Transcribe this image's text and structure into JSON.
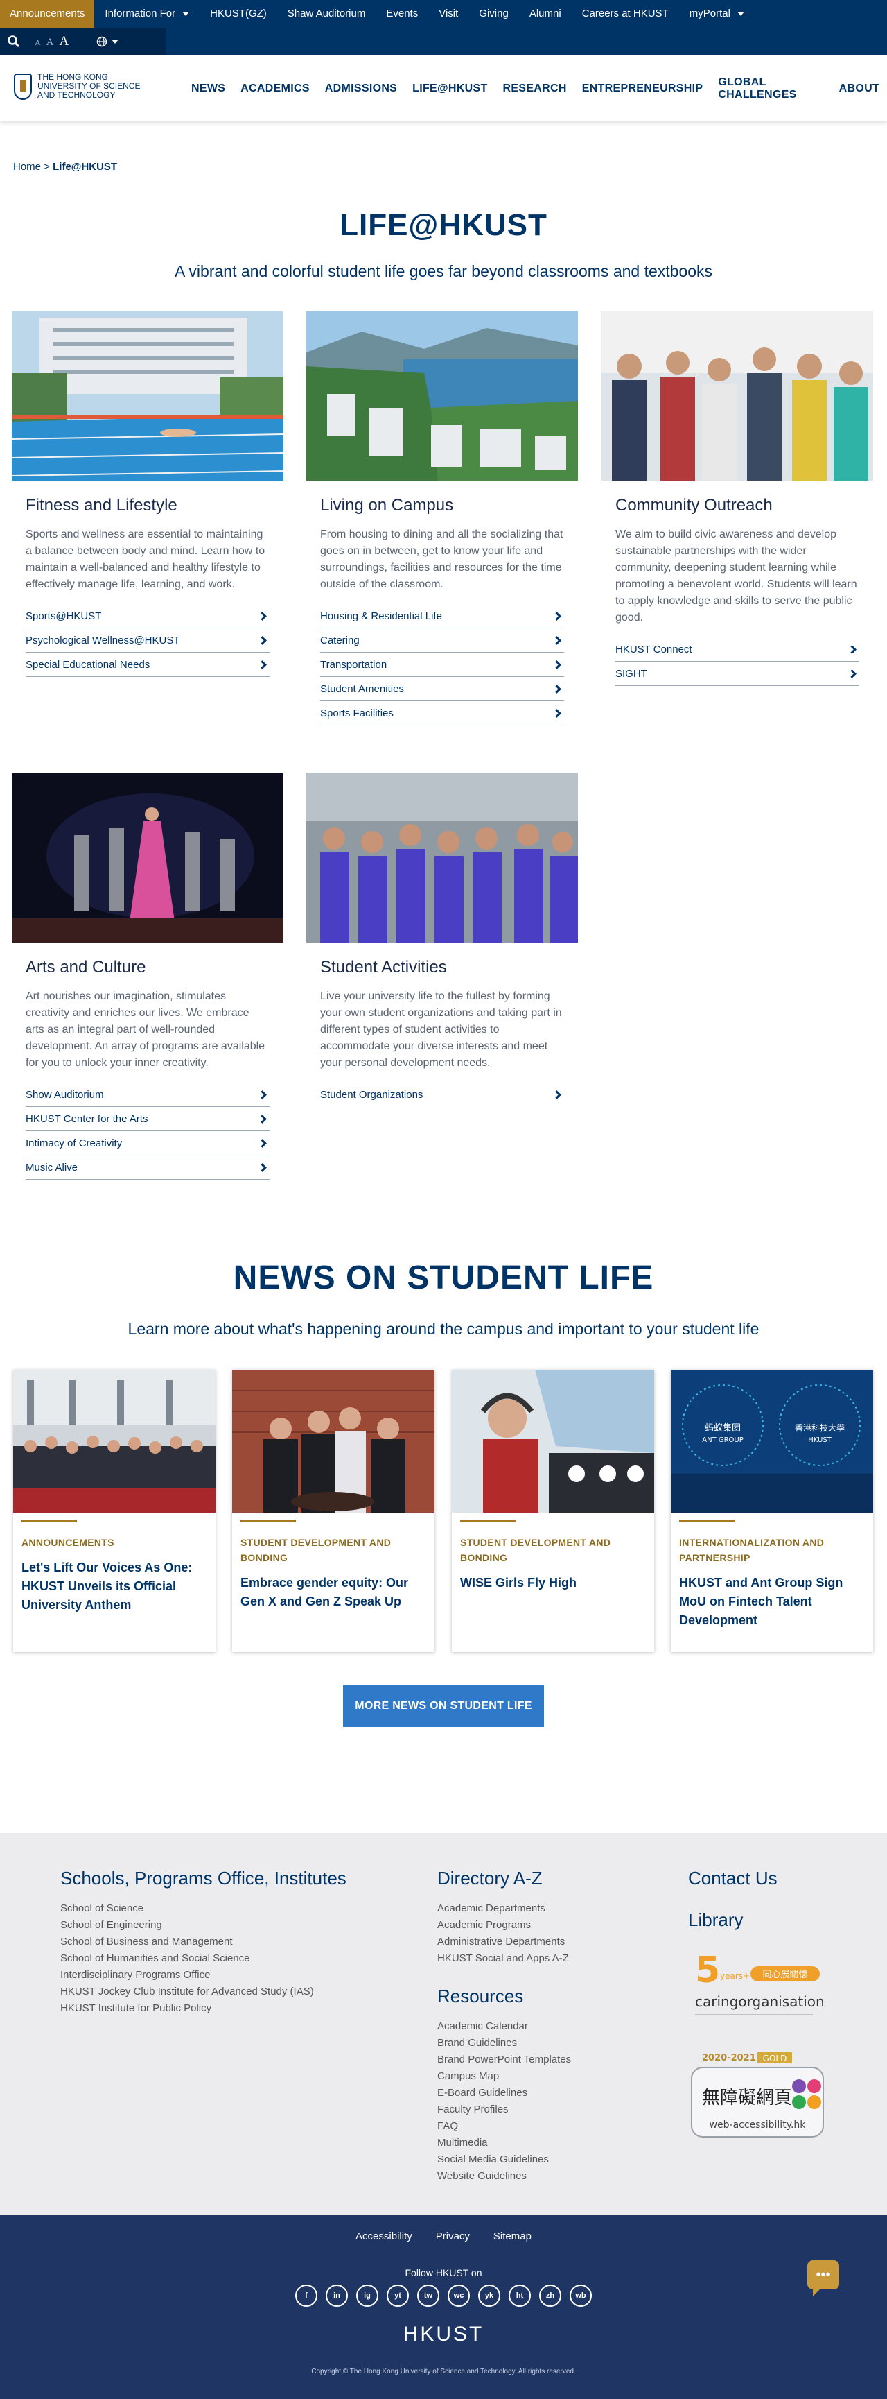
{
  "topnav": {
    "announcements": "Announcements",
    "items": [
      "Information For",
      "HKUST(GZ)",
      "Shaw Auditorium",
      "Events",
      "Visit",
      "Giving",
      "Alumni",
      "Careers at HKUST",
      "myPortal"
    ],
    "font_sizes": [
      "A",
      "A",
      "A"
    ]
  },
  "header": {
    "logo_text": "THE HONG KONG UNIVERSITY OF SCIENCE AND TECHNOLOGY",
    "nav": [
      "NEWS",
      "ACADEMICS",
      "ADMISSIONS",
      "LIFE@HKUST",
      "RESEARCH",
      "ENTREPRENEURSHIP",
      "GLOBAL CHALLENGES",
      "ABOUT"
    ]
  },
  "breadcrumb": {
    "home": "Home",
    "sep": " > ",
    "current": "Life@HKUST"
  },
  "hero": {
    "title": "LIFE@HKUST",
    "subtitle": "A vibrant and colorful student life goes far beyond classrooms and textbooks"
  },
  "cards": [
    {
      "title": "Fitness and Lifestyle",
      "text": "Sports and wellness are essential to maintaining a balance between body and mind. Learn how to maintain a well-balanced and healthy lifestyle to effectively manage life, learning, and work.",
      "links": [
        "Sports@HKUST",
        "Psychological Wellness@HKUST",
        "Special Educational Needs"
      ]
    },
    {
      "title": "Living on Campus",
      "text": "From housing to dining and all the socializing that goes on in between, get to know your life and surroundings, facilities and resources for the time outside of the classroom.",
      "links": [
        "Housing & Residential Life",
        "Catering",
        "Transportation",
        "Student Amenities",
        "Sports Facilities"
      ]
    },
    {
      "title": "Community Outreach",
      "text": "We aim to build civic awareness and develop sustainable partnerships with the wider community, deepening student learning while promoting a benevolent world. Students will learn to apply knowledge and skills to serve the public good.",
      "links": [
        "HKUST Connect",
        "SIGHT"
      ]
    },
    {
      "title": "Arts and Culture",
      "text": "Art nourishes our imagination, stimulates creativity and enriches our lives. We embrace arts as an integral part of well-rounded development. An array of programs are available for you to unlock your inner creativity.",
      "links": [
        "Show Auditorium",
        "HKUST Center for the Arts",
        "Intimacy of Creativity",
        "Music Alive"
      ]
    },
    {
      "title": "Student Activities",
      "text": "Live your university life to the fullest by forming your own student organizations and taking part in different types of student activities to accommodate your diverse interests and meet your personal development needs.",
      "links": [
        "Student Organizations"
      ]
    }
  ],
  "news": {
    "title": "NEWS ON STUDENT LIFE",
    "subtitle": "Learn more about what's happening around the campus and important to your student life",
    "items": [
      {
        "category": "ANNOUNCEMENTS",
        "title": "Let's Lift Our Voices As One: HKUST Unveils its Official University Anthem"
      },
      {
        "category": "STUDENT DEVELOPMENT AND BONDING",
        "title": "Embrace gender equity: Our Gen X and Gen Z Speak Up"
      },
      {
        "category": "STUDENT DEVELOPMENT AND BONDING",
        "title": "WISE Girls Fly High"
      },
      {
        "category": "INTERNATIONALIZATION AND PARTNERSHIP",
        "title": "HKUST and Ant Group Sign MoU on Fintech Talent Development",
        "image_text": [
          "蚂蚁集团",
          "ANT GROUP",
          "香港科技大學",
          "HKUST"
        ]
      }
    ],
    "more_button": "MORE NEWS ON STUDENT LIFE"
  },
  "footer": {
    "schools_title": "Schools, Programs Office, Institutes",
    "schools": [
      "School of Science",
      "School of Engineering",
      "School of Business and Management",
      "School of Humanities and Social Science",
      "Interdisciplinary Programs Office",
      "HKUST Jockey Club Institute for Advanced Study (IAS)",
      "HKUST Institute for Public Policy"
    ],
    "directory_title": "Directory A-Z",
    "directory": [
      "Academic Departments",
      "Academic Programs",
      "Administrative Departments",
      "HKUST Social and Apps A-Z"
    ],
    "resources_title": "Resources",
    "resources": [
      "Academic Calendar",
      "Brand Guidelines",
      "Brand PowerPoint Templates",
      "Campus Map",
      "E-Board Guidelines",
      "Faculty Profiles",
      "FAQ",
      "Multimedia",
      "Social Media Guidelines",
      "Website Guidelines"
    ],
    "contact": "Contact Us",
    "library": "Library",
    "caring_badge": {
      "years": "5",
      "suffix": "years+",
      "label": "caringorganisation",
      "chinese": "同心展關懷"
    },
    "accessibility_badge": {
      "years": "2020-2021",
      "rank": "GOLD",
      "chinese": "無障礙網頁",
      "url": "web-accessibility.hk"
    },
    "bottom_links": [
      "Accessibility",
      "Privacy",
      "Sitemap"
    ],
    "follow": "Follow HKUST on",
    "socials": [
      "f",
      "in",
      "ig",
      "yt",
      "tw",
      "wc",
      "yk",
      "ht",
      "zh",
      "wb"
    ],
    "logo": "HKUST",
    "copyright": "Copyright © The Hong Kong University of Science and Technology. All rights reserved."
  }
}
